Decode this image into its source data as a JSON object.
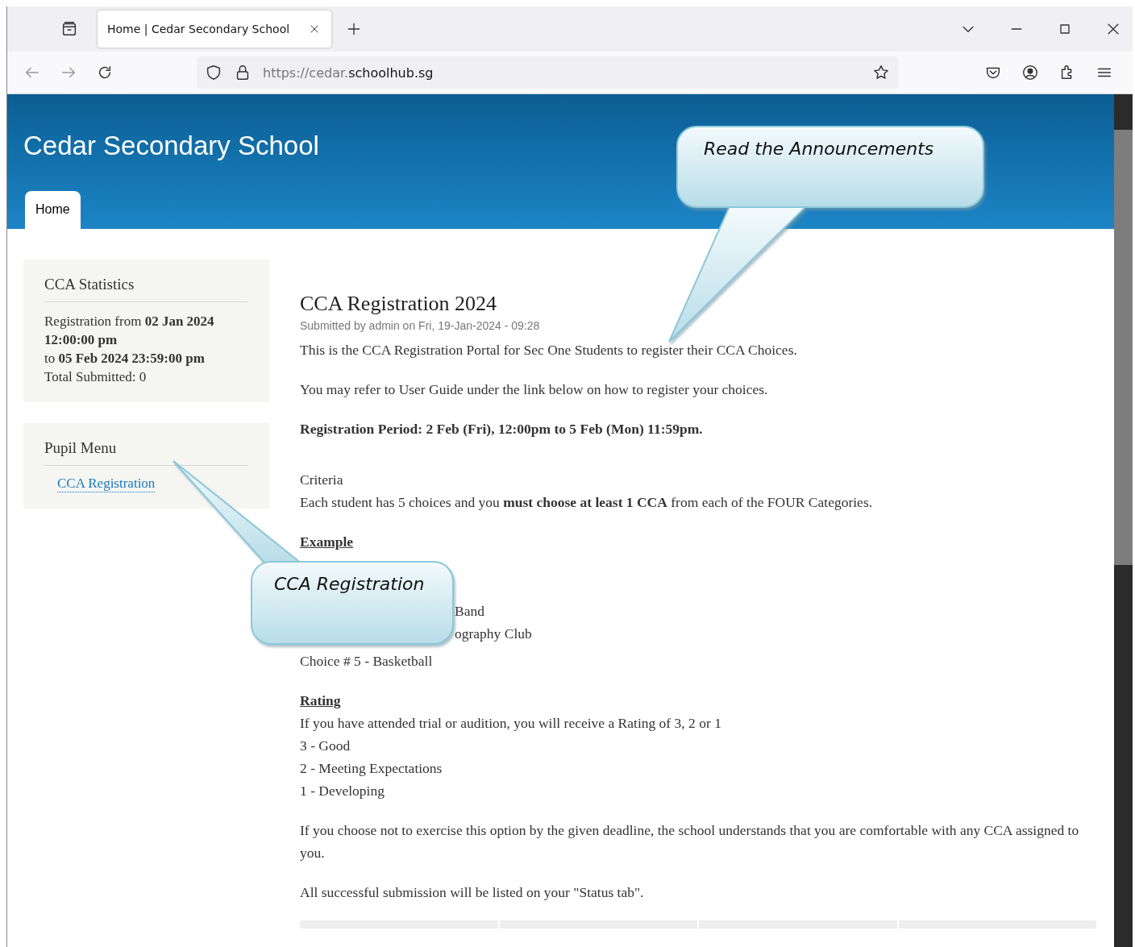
{
  "browser": {
    "tab": {
      "title": "Home | Cedar Secondary School",
      "selected": true
    },
    "url": {
      "dim": "https://cedar.",
      "main": "schoolhub.sg"
    }
  },
  "site": {
    "title": "Cedar Secondary School",
    "nav": [
      {
        "label": "Home",
        "selected": true
      }
    ]
  },
  "sidebar": [
    {
      "title": "CCA Statistics",
      "lines": [
        "Registration from **02 Jan 2024 12:00:00 pm**",
        "to **05 Feb 2024 23:59:00 pm**",
        "Total Submitted: 0"
      ]
    },
    {
      "title": "Pupil Menu",
      "links": [
        "CCA Registration"
      ]
    }
  ],
  "article": {
    "title": "CCA Registration 2024",
    "meta": "Submitted by admin on Fri, 19-Jan-2024 - 09:28",
    "blocks": [
      {
        "kind": "paragraph",
        "text": "This is the CCA Registration Portal for Sec One Students to register their CCA Choices."
      },
      {
        "kind": "paragraph",
        "text": "You may refer to User Guide under the link below on how to register your choices."
      },
      {
        "kind": "strong",
        "text": "Registration Period: 2 Feb (Fri), 12:00pm to 5 Feb (Mon) 11:59pm."
      },
      {
        "kind": "lines",
        "lines": [
          "Criteria",
          "Each student has 5 choices and you **must choose at least 1 CCA** from each of the FOUR Categories."
        ]
      },
      {
        "kind": "example",
        "heading": "Example",
        "lines": [
          {
            "kind": "partial",
            "text": "Band"
          },
          {
            "kind": "partial",
            "text": "ography Club"
          },
          {
            "kind": "full",
            "text": "Choice # 5 - Basketball"
          }
        ]
      },
      {
        "kind": "section",
        "heading": "Rating",
        "lines": [
          "If you have attended trial or audition, you will receive a Rating of 3, 2 or 1",
          "3 - Good",
          "2 - Meeting Expectations",
          "1 - Developing"
        ]
      },
      {
        "kind": "paragraph",
        "text": "If you choose not to exercise this option by the given deadline, the school understands that you are comfortable with any CCA assigned to you."
      },
      {
        "kind": "paragraph",
        "text": "All successful submission will be listed on your \"Status tab\"."
      },
      {
        "kind": "table"
      }
    ]
  },
  "callouts": [
    {
      "text": "Read the Announcements"
    },
    {
      "text": "CCA Registration"
    }
  ]
}
